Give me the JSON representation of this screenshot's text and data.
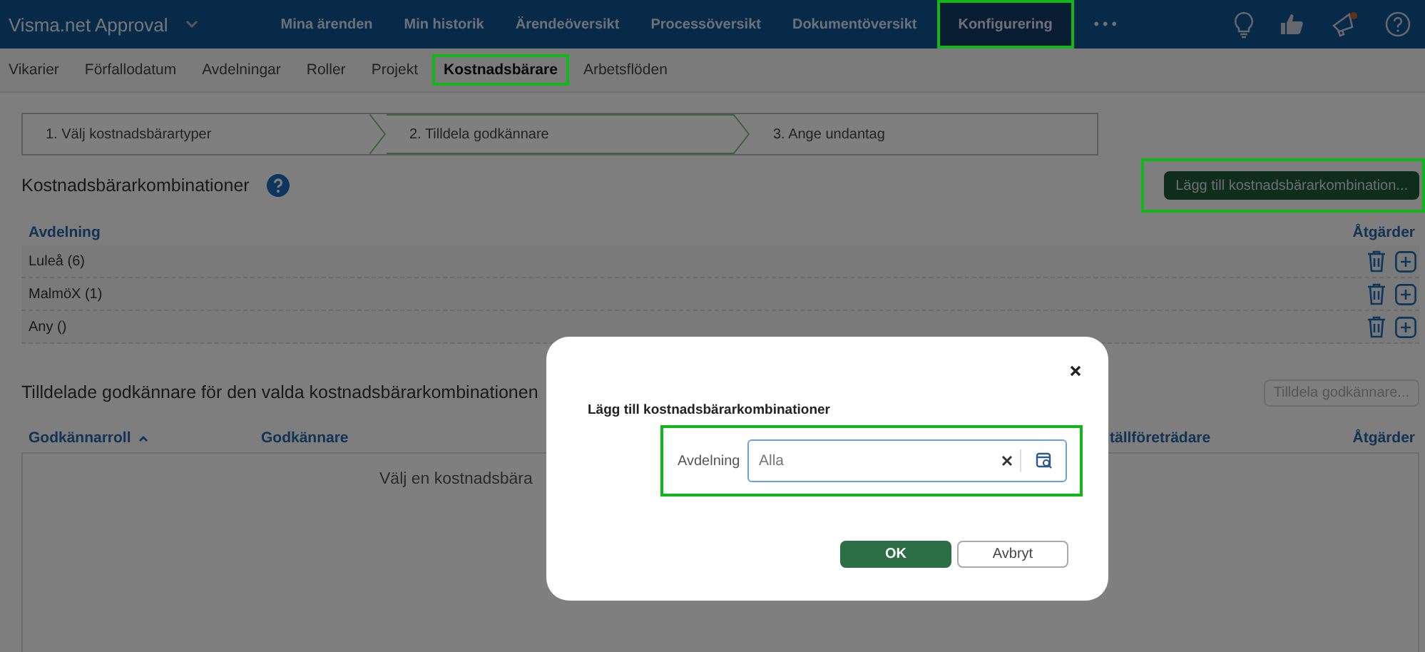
{
  "app": {
    "title": "Visma.net Approval",
    "menu": [
      {
        "label": "Mina ärenden",
        "selected": false,
        "highlighted": false
      },
      {
        "label": "Min historik",
        "selected": false,
        "highlighted": false
      },
      {
        "label": "Ärendeöversikt",
        "selected": false,
        "highlighted": false
      },
      {
        "label": "Processöversikt",
        "selected": false,
        "highlighted": false
      },
      {
        "label": "Dokumentöversikt",
        "selected": false,
        "highlighted": false
      },
      {
        "label": "Konfigurering",
        "selected": true,
        "highlighted": true
      }
    ],
    "more": "• • •"
  },
  "subtabs": [
    {
      "label": "Vikarier",
      "selected": false,
      "highlighted": false
    },
    {
      "label": "Förfallodatum",
      "selected": false,
      "highlighted": false
    },
    {
      "label": "Avdelningar",
      "selected": false,
      "highlighted": false
    },
    {
      "label": "Roller",
      "selected": false,
      "highlighted": false
    },
    {
      "label": "Projekt",
      "selected": false,
      "highlighted": false
    },
    {
      "label": "Kostnadsbärare",
      "selected": true,
      "highlighted": true
    },
    {
      "label": "Arbetsflöden",
      "selected": false,
      "highlighted": false
    }
  ],
  "steps": [
    {
      "label": "1. Välj kostnadsbärartyper",
      "selected": false
    },
    {
      "label": "2. Tilldela godkännare",
      "selected": true
    },
    {
      "label": "3. Ange undantag",
      "selected": false
    }
  ],
  "combinations": {
    "title": "Kostnadsbärarkombinationer",
    "add_button": {
      "label": "Lägg till kostnadsbärarkombination...",
      "highlighted": true
    },
    "columns": [
      "Avdelning",
      "Åtgärder"
    ],
    "rows": [
      "Luleå (6)",
      "MalmöX (1)",
      "Any ()"
    ]
  },
  "approvers": {
    "title": "Tilldelade godkännare för den valda kostnadsbärarkombinationen",
    "assign_button": {
      "label": "Tilldela godkännare...",
      "disabled": true
    },
    "columns": [
      {
        "label": "Godkännarroll",
        "sorted": true
      },
      {
        "label": "Godkännare",
        "sorted": false
      },
      {
        "label": "tällföreträdare",
        "sorted": false
      },
      {
        "label": "Åtgärder",
        "sorted": false
      }
    ],
    "empty_text": "Välj en kostnadsbära"
  },
  "dialog": {
    "title": "Lägg till kostnadsbärarkombinationer",
    "field": {
      "label": "Avdelning",
      "placeholder": "Alla",
      "highlighted": true
    },
    "buttons": [
      {
        "label": "OK",
        "kind": "primary"
      },
      {
        "label": "Avbryt",
        "kind": "secondary"
      }
    ]
  }
}
